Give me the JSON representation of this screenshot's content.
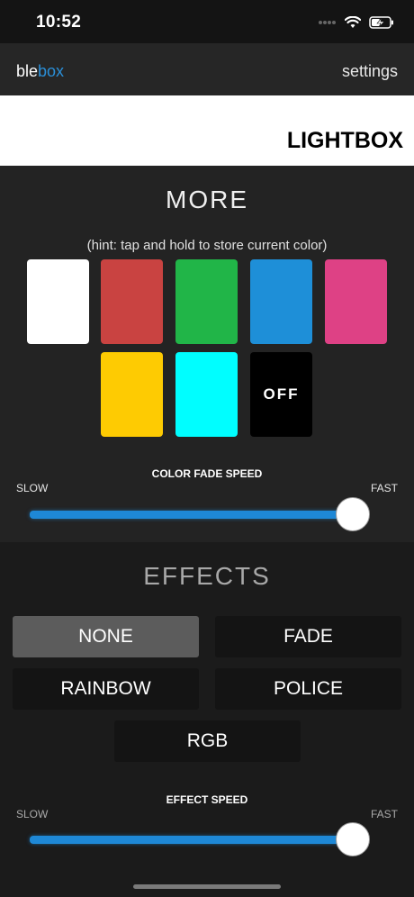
{
  "status": {
    "time": "10:52"
  },
  "nav": {
    "brand_part1": "ble",
    "brand_part2": "box",
    "settings_label": "settings"
  },
  "device": {
    "title": "LIGHTBOX"
  },
  "more": {
    "heading": "MORE",
    "hint": "(hint: tap and hold to store current color)",
    "swatches": [
      {
        "name": "white",
        "color": "#ffffff",
        "label": ""
      },
      {
        "name": "red",
        "color": "#c94341",
        "label": ""
      },
      {
        "name": "green",
        "color": "#21b548",
        "label": ""
      },
      {
        "name": "blue",
        "color": "#1e8fd8",
        "label": ""
      },
      {
        "name": "pink",
        "color": "#de4185",
        "label": ""
      },
      {
        "name": "yellow",
        "color": "#fecb02",
        "label": ""
      },
      {
        "name": "cyan",
        "color": "#00feff",
        "label": ""
      },
      {
        "name": "off",
        "color": "#000000",
        "label": "OFF"
      }
    ],
    "fade_speed": {
      "label": "COLOR FADE SPEED",
      "min_label": "SLOW",
      "max_label": "FAST",
      "value": 1.0
    }
  },
  "effects": {
    "heading": "EFFECTS",
    "buttons": [
      {
        "label": "NONE",
        "active": true
      },
      {
        "label": "FADE",
        "active": false
      },
      {
        "label": "RAINBOW",
        "active": false
      },
      {
        "label": "POLICE",
        "active": false
      },
      {
        "label": "RGB",
        "active": false
      }
    ],
    "effect_speed": {
      "label": "EFFECT SPEED",
      "min_label": "SLOW",
      "max_label": "FAST",
      "value": 1.0
    }
  },
  "colors": {
    "accent": "#2a8fd8",
    "slider": "#1e88d6",
    "active_button": "#5c5c5c"
  }
}
